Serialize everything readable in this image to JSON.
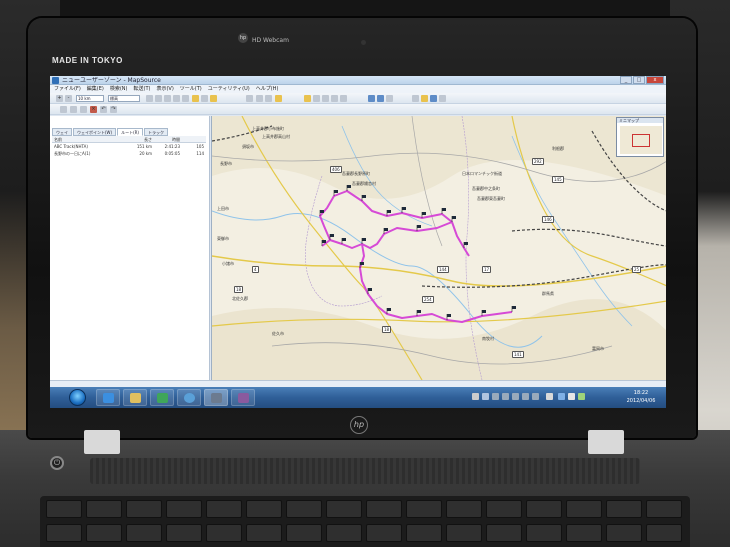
{
  "bezel": {
    "brand": "MADE IN TOKYO",
    "webcam": "HD Webcam",
    "hp": "hp"
  },
  "window": {
    "title": "ニューユーザーゾーン - MapSource",
    "controls": {
      "minimize": "_",
      "maximize": "□",
      "close": "x"
    }
  },
  "menu": [
    "ファイル(F)",
    "編集(E)",
    "検索(N)",
    "転送(T)",
    "表示(V)",
    "ツール(T)",
    "ユーティリティ(U)",
    "ヘルプ(H)"
  ],
  "toolbar": {
    "zoom_select": "10 km",
    "map_select": "標高"
  },
  "left_pane": {
    "tabs": [
      "ウェイ",
      "ウェイポイント(W)",
      "ルート(R)",
      "トラック"
    ],
    "active_tab": 2,
    "columns": [
      "名前",
      "長さ",
      "時間"
    ],
    "rows": [
      {
        "name": "ABC Track(NHTA)",
        "length": "151 km",
        "time": "2:41:23",
        "extra": "105"
      },
      {
        "name": "長野市の一日にA(1)",
        "length": "20 km",
        "time": "0:05:05",
        "extra": "114"
      }
    ]
  },
  "map": {
    "overview_title": "ミニマップ",
    "labels": [
      "上高井郡小布施町",
      "上高井郡高山村",
      "須坂市",
      "長野市",
      "日本ロマンチック街道",
      "吾妻郡長野原町",
      "吾妻郡中之条町",
      "吾妻郡東吾妻町",
      "吾妻郡嬬恋村",
      "北佐久郡",
      "佐久市",
      "群馬県",
      "利根郡",
      "南牧村",
      "小諸市",
      "東御市",
      "上田市",
      "富岡市"
    ],
    "shields": [
      "406",
      "144",
      "292",
      "18",
      "254",
      "141",
      "146",
      "4",
      "17",
      "145",
      "18",
      "25"
    ]
  },
  "status": {
    "text": "アイテムが選択されていません  ヘルプを表示するには F1 を押してください  N36 21.849 E138 21.858"
  },
  "taskbar": {
    "clock_time": "18:22",
    "clock_date": "2012/04/06"
  }
}
